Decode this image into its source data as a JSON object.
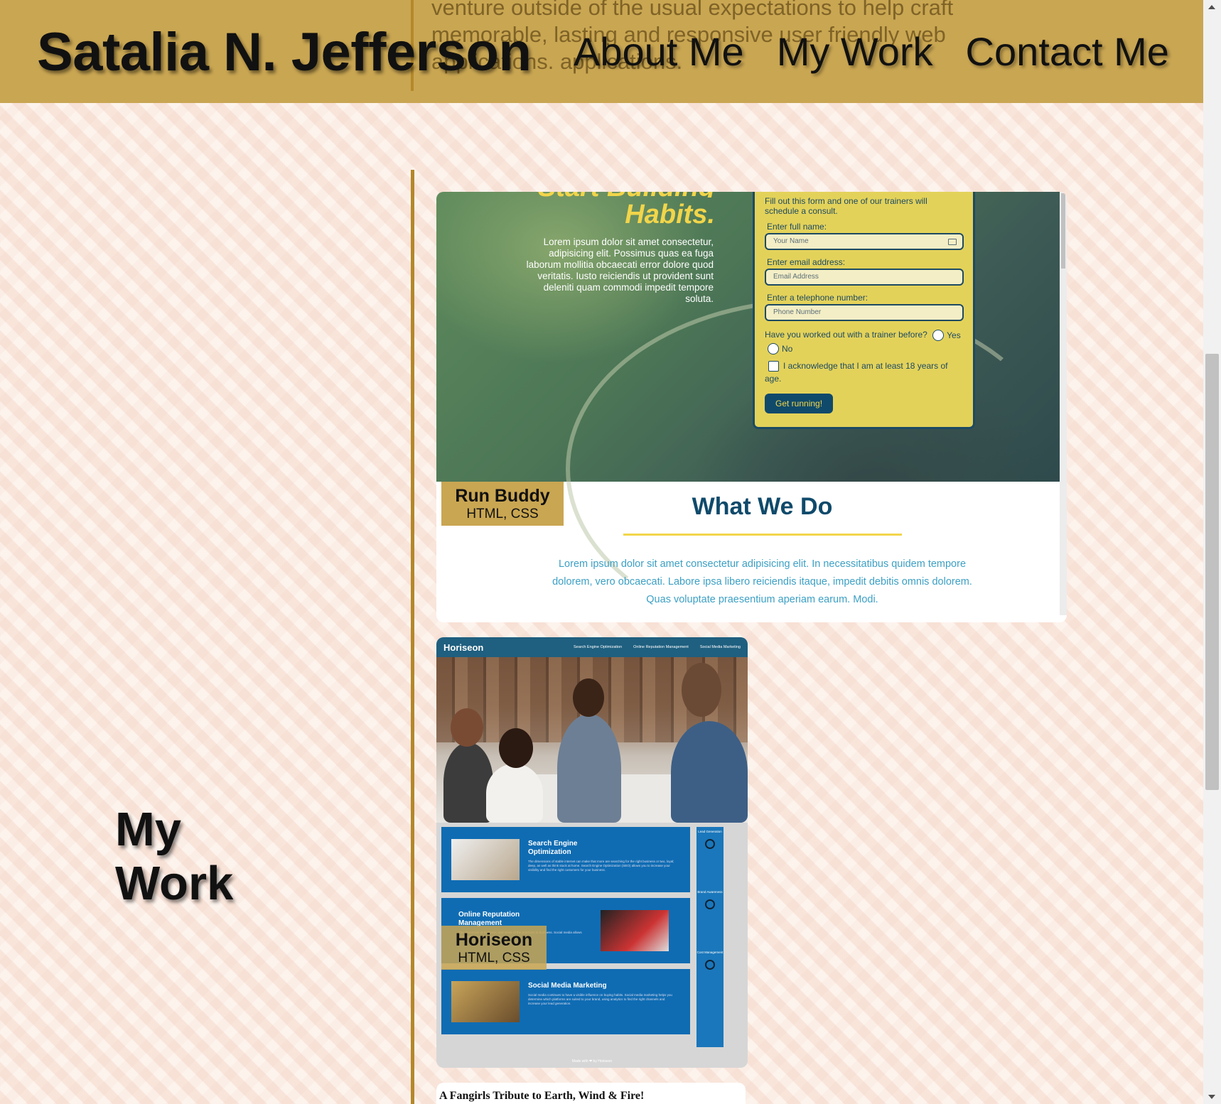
{
  "header": {
    "site_name": "Satalia N. Jefferson",
    "nav": [
      "About Me",
      "My Work",
      "Contact Me"
    ],
    "behind_text": "venture outside of the usual expectations to help craft memorable, lasting and responsive user friendly web applications. applications."
  },
  "section": {
    "title_line1": "My",
    "title_line2": "Work"
  },
  "projects": [
    {
      "name": "Run Buddy",
      "tech": "HTML, CSS",
      "preview": {
        "headline_cut": "Start Building",
        "headline": "Habits.",
        "lorem": "Lorem ipsum dolor sit amet consectetur, adipisicing elit. Possimus quas ea fuga laborum mollitia obcaecati error dolore quod veritatis. Iusto reiciendis ut provident sunt deleniti quam commodi impedit tempore soluta.",
        "form_intro": "Fill out this form and one of our trainers will schedule a consult.",
        "name_label": "Enter full name:",
        "name_placeholder": "Your Name",
        "email_label": "Enter email address:",
        "email_placeholder": "Email Address",
        "phone_label": "Enter a telephone number:",
        "phone_placeholder": "Phone Number",
        "question": "Have you worked out with a trainer before?",
        "yes": "Yes",
        "no": "No",
        "ack": "I acknowledge that I am at least 18 years of age.",
        "button": "Get running!",
        "what_title": "What We Do",
        "what_text": "Lorem ipsum dolor sit amet consectetur adipisicing elit. In necessitatibus quidem tempore dolorem, vero obcaecati. Labore ipsa libero reiciendis itaque, impedit debitis omnis dolorem. Quas voluptate praesentium aperiam earum. Modi."
      }
    },
    {
      "name": "Horiseon",
      "tech": "HTML, CSS",
      "preview": {
        "logo": "Horiseon",
        "links": [
          "Search Engine Optimization",
          "Online Reputation Management",
          "Social Media Marketing"
        ],
        "box1_title": "Search Engine Optimization",
        "box1_text": "The dimensions of stable internet can make that more are searching for the right business or two, loyal; deep, as well as think stuck at home. Search Engine Optimization (SEO) allows you to increase your visibility and find the right customers for your business.",
        "box2_title": "Online Reputation Management",
        "box2_text": "The dimension of business, and some of the practices to business. Social media allows small talk about your business.",
        "box3_title": "Social Media Marketing",
        "box3_text": "Social media continues to have a visible influence on buying habits. Social media marketing helps you determine which platforms are suited to your brand, using analytics to find the right channels and increase your lead generation.",
        "side1": "Lead Generation",
        "side2": "Brand Awareness",
        "side3": "Cost Management",
        "footer": "Made with ❤ by Horiseon"
      }
    },
    {
      "name": "A Fangirls Tribute to Earth, Wind & Fire!"
    }
  ],
  "colors": {
    "header_bg": "#c9a652",
    "accent_line": "#b4882a",
    "runbuddy_navy": "#0f4a6b",
    "runbuddy_yellow": "#f2d54a",
    "horiseon_blue": "#0f6cb3"
  }
}
